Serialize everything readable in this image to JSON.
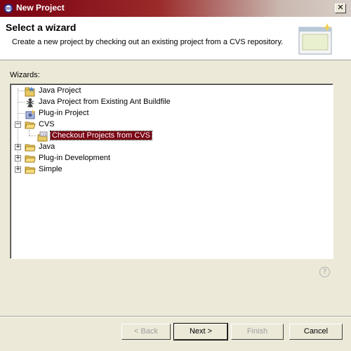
{
  "window": {
    "title": "New Project",
    "close_glyph": "✕"
  },
  "banner": {
    "title": "Select a wizard",
    "description": "Create a new project by checking out an existing project from a CVS repository.",
    "icon": "new-project-wizard-icon"
  },
  "wizards_label": "Wizards:",
  "tree": {
    "items": [
      {
        "label": "Java Project",
        "icon": "java-project-icon"
      },
      {
        "label": "Java Project from Existing Ant Buildfile",
        "icon": "ant-icon"
      },
      {
        "label": "Plug-in Project",
        "icon": "plugin-project-icon"
      },
      {
        "label": "CVS",
        "icon": "folder-open-icon",
        "expanded": true
      },
      {
        "label": "Checkout Projects from CVS",
        "icon": "cvs-checkout-icon",
        "selected": true
      },
      {
        "label": "Java",
        "icon": "folder-icon",
        "expanded": false
      },
      {
        "label": "Plug-in Development",
        "icon": "folder-icon",
        "expanded": false
      },
      {
        "label": "Simple",
        "icon": "folder-icon",
        "expanded": false
      }
    ],
    "expander_plus": "+",
    "expander_minus": "−"
  },
  "help_glyph": "?",
  "buttons": {
    "back": "< Back",
    "next": "Next >",
    "finish": "Finish",
    "cancel": "Cancel"
  },
  "colors": {
    "titlebar": "#7a0012",
    "selection": "#7a0012",
    "dialog_bg": "#ece9d8"
  }
}
